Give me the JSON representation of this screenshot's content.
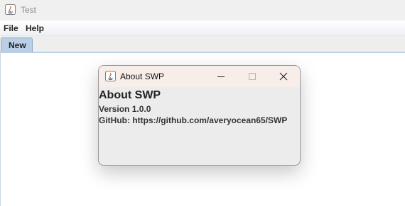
{
  "window": {
    "title": "Test"
  },
  "menubar": {
    "items": [
      "File",
      "Help"
    ]
  },
  "tabs": [
    {
      "label": "New"
    }
  ],
  "dialog": {
    "title": "About SWP",
    "heading": "About SWP",
    "version": "Version 1.0.0",
    "github": "GitHub: https://github.com/averyocean65/SWP"
  },
  "colors": {
    "tab_active": "#b8cfe5",
    "dialog_titlebar": "#f7ede9"
  }
}
